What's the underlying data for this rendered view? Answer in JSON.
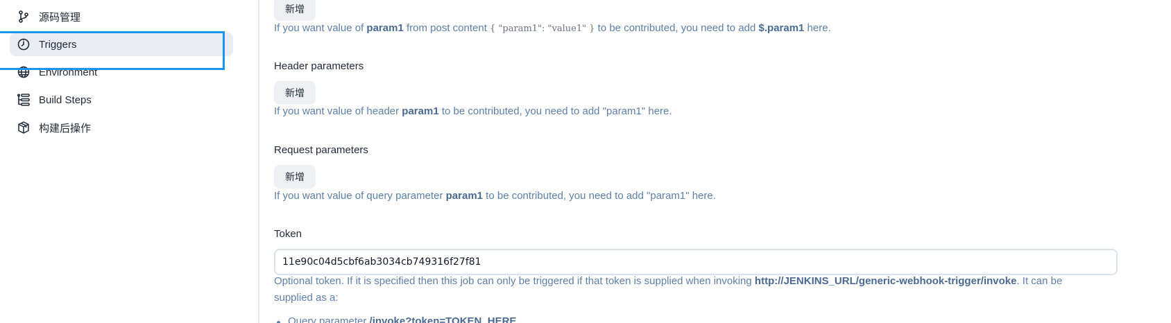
{
  "sidebar": {
    "items": [
      {
        "label": "源码管理",
        "icon": "source-branch-icon"
      },
      {
        "label": "Triggers",
        "icon": "timer-icon",
        "active": true
      },
      {
        "label": "Environment",
        "icon": "globe-icon"
      },
      {
        "label": "Build Steps",
        "icon": "list-steps-icon"
      },
      {
        "label": "构建后操作",
        "icon": "package-icon"
      }
    ]
  },
  "main": {
    "post_content": {
      "add_label": "新增",
      "help_prefix": "If you want value of ",
      "help_param": "param1",
      "help_mid": " from post content ",
      "help_code": "{ \"param1\": \"value1\" }",
      "help_mid2": " to be contributed, you need to add ",
      "help_path": "$.param1",
      "help_suffix": " here."
    },
    "header_params": {
      "label": "Header parameters",
      "add_label": "新增",
      "help_prefix": "If you want value of header ",
      "help_param": "param1",
      "help_suffix": " to be contributed, you need to add \"param1\" here."
    },
    "request_params": {
      "label": "Request parameters",
      "add_label": "新增",
      "help_prefix": "If you want value of query parameter ",
      "help_param": "param1",
      "help_suffix": " to be contributed, you need to add \"param1\" here."
    },
    "token": {
      "label": "Token",
      "value": "11e90c04d5cbf6ab3034cb749316f27f81",
      "help_prefix": "Optional token. If it is specified then this job can only be triggered if that token is supplied when invoking ",
      "help_url": "http://JENKINS_URL/generic-webhook-trigger/invoke",
      "help_suffix": ". It can be supplied as a:",
      "bullet_prefix": "Query parameter ",
      "bullet_value": "/invoke?token=TOKEN_HERE"
    }
  },
  "colors": {
    "accent_highlight": "#1a96f0",
    "help_text": "#5d7fa6",
    "active_bg": "#e9ecf2"
  }
}
